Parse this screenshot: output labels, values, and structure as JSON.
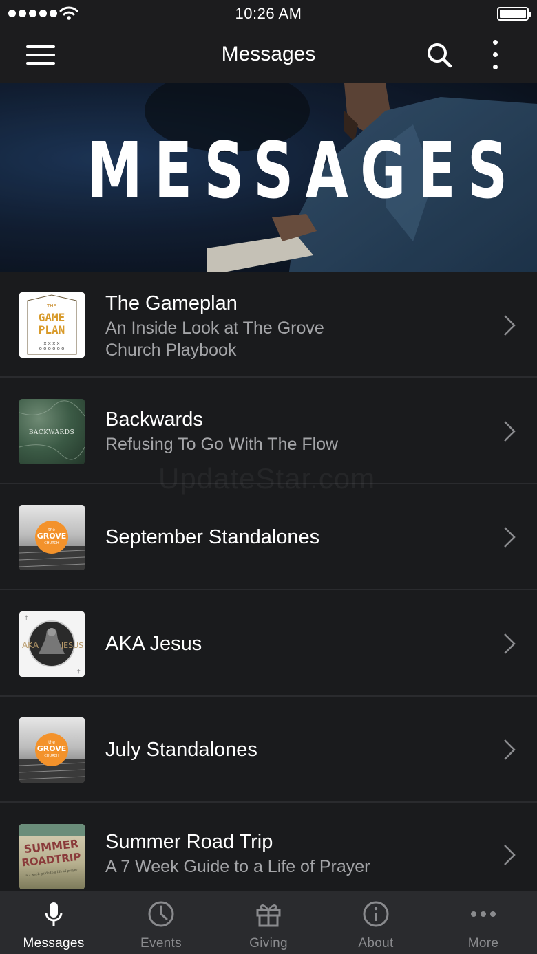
{
  "status_bar": {
    "time": "10:26 AM"
  },
  "nav": {
    "title": "Messages"
  },
  "hero": {
    "banner_text": "MESSAGES"
  },
  "series": [
    {
      "title": "The Gameplan",
      "subtitle_line1": "An Inside Look at The Grove",
      "subtitle_line2": "Church Playbook",
      "thumb_text_1": "THE",
      "thumb_text_2": "GAME",
      "thumb_text_3": "PLAN"
    },
    {
      "title": "Backwards",
      "subtitle_line1": "Refusing To Go With The Flow",
      "subtitle_line2": "",
      "thumb_text_1": "BACKWARDS"
    },
    {
      "title": "September Standalones",
      "subtitle_line1": "",
      "subtitle_line2": "",
      "thumb_text_1": "the",
      "thumb_text_2": "GROVE",
      "thumb_text_3": "CHURCH"
    },
    {
      "title": "AKA Jesus",
      "subtitle_line1": "",
      "subtitle_line2": "",
      "thumb_text_1": "AKA",
      "thumb_text_2": "JESUS"
    },
    {
      "title": "July Standalones",
      "subtitle_line1": "",
      "subtitle_line2": "",
      "thumb_text_1": "the",
      "thumb_text_2": "GROVE",
      "thumb_text_3": "CHURCH"
    },
    {
      "title": "Summer Road Trip",
      "subtitle_line1": "A 7 Week Guide to a Life of Prayer",
      "subtitle_line2": "",
      "thumb_text_1": "SUMMER",
      "thumb_text_2": "ROADTRIP",
      "thumb_text_3": "a 7 week guide to a life of prayer"
    }
  ],
  "watermark": "UpdateStar.com",
  "tabs": [
    {
      "label": "Messages",
      "icon": "microphone-icon",
      "active": true
    },
    {
      "label": "Events",
      "icon": "clock-icon",
      "active": false
    },
    {
      "label": "Giving",
      "icon": "gift-icon",
      "active": false
    },
    {
      "label": "About",
      "icon": "info-icon",
      "active": false
    },
    {
      "label": "More",
      "icon": "ellipsis-icon",
      "active": false
    }
  ],
  "colors": {
    "background": "#1a1b1d",
    "navbar": "#1c1c1e",
    "tabbar": "#2a2b2e",
    "subtitle": "#a4a5a8",
    "accent_orange": "#f3922b"
  }
}
